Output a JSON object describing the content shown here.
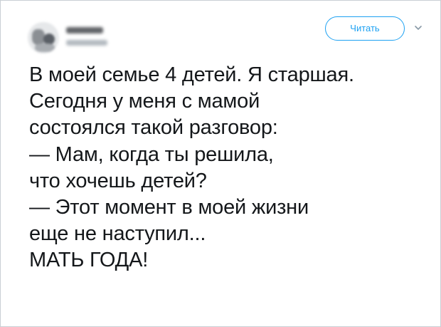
{
  "header": {
    "follow_label": "Читать"
  },
  "tweet": {
    "lines": [
      "В моей семье 4 детей. Я старшая.",
      "Сегодня у меня с мамой",
      "состоялся такой разговор:",
      "— Мам, когда ты решила,",
      "что хочешь детей?",
      "— Этот момент в моей жизни",
      "еще не наступил...",
      "МАТЬ ГОДА!"
    ]
  },
  "icons": {
    "menu": "chevron-down-icon",
    "avatar": "avatar"
  },
  "colors": {
    "accent": "#1da1f2",
    "text": "#14171a",
    "border": "#c9cfd4",
    "chevron": "#8899a6"
  }
}
